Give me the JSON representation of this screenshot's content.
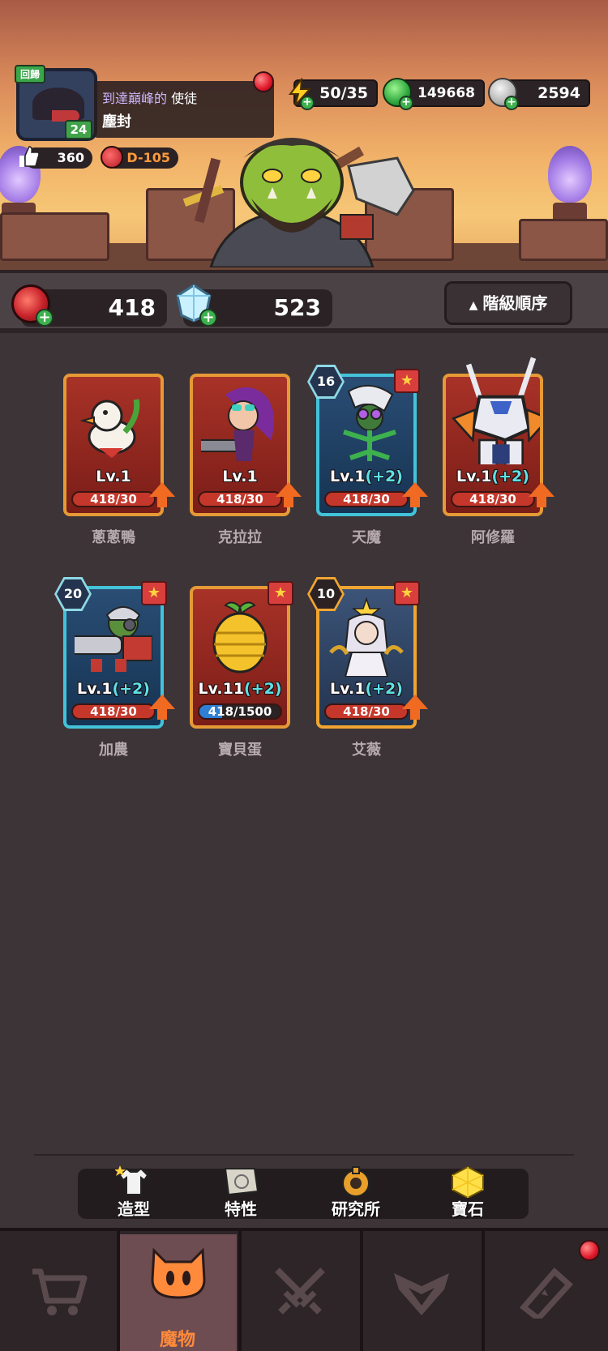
{
  "player": {
    "tag": "回歸",
    "level": "24",
    "title_prefix": "到達巔峰的",
    "title_role": "使徒",
    "name": "塵封",
    "likes": "360",
    "rank": "D-105"
  },
  "resources": {
    "energy": "50/35",
    "emerald": "149668",
    "coin": "2594"
  },
  "bar": {
    "red_orb": "418",
    "crystal": "523",
    "sort_label": "階級順序"
  },
  "cards": [
    {
      "name": "蔥蔥鴨",
      "level": "Lv.1",
      "bonus": "",
      "progress": "418/30",
      "style": "red",
      "badge": "",
      "star": false
    },
    {
      "name": "克拉拉",
      "level": "Lv.1",
      "bonus": "",
      "progress": "418/30",
      "style": "red",
      "badge": "",
      "star": false
    },
    {
      "name": "天魔",
      "level": "Lv.1",
      "bonus": "(+2)",
      "progress": "418/30",
      "style": "blue",
      "badge": "16",
      "star": true
    },
    {
      "name": "阿修羅",
      "level": "Lv.1",
      "bonus": "(+2)",
      "progress": "418/30",
      "style": "red",
      "badge": "",
      "star": false
    },
    {
      "name": "加農",
      "level": "Lv.1",
      "bonus": "(+2)",
      "progress": "418/30",
      "style": "blue",
      "badge": "20",
      "star": true
    },
    {
      "name": "寶貝蛋",
      "level": "Lv.11",
      "bonus": "(+2)",
      "progress": "418/1500",
      "style": "red",
      "badge": "",
      "star": true
    },
    {
      "name": "艾薇",
      "level": "Lv.1",
      "bonus": "(+2)",
      "progress": "418/30",
      "style": "gold",
      "badge": "10",
      "star": true
    }
  ],
  "submenu": [
    "造型",
    "特性",
    "研究所",
    "寶石"
  ],
  "nav": {
    "active_label": "魔物",
    "tabs": [
      "shop-cart-icon",
      "monster-icon",
      "crossed-swords-icon",
      "rank-wings-icon",
      "ticket-icon"
    ]
  },
  "colors": {
    "background": "#3d3438",
    "accent_orange": "#ff8a3c",
    "bonus_cyan": "#5ee1e6"
  }
}
